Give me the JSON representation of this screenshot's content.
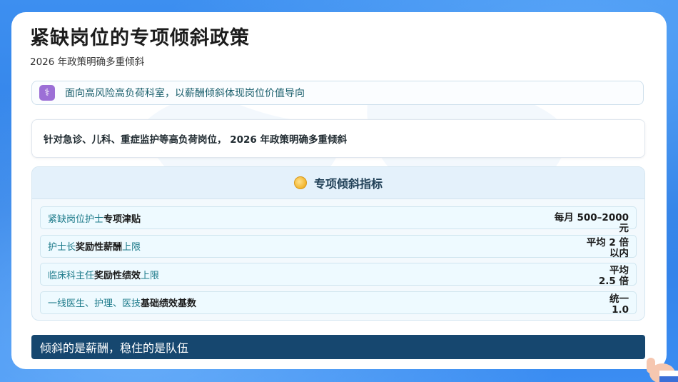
{
  "page": {
    "title": "紧缺岗位的专项倾斜政策",
    "subtitle": "2026 年政策明确多重倾斜"
  },
  "banner": {
    "icon": "medical-caduceus-icon",
    "text": "面向高风险高负荷科室，以薪酬倾斜体现岗位价值导向"
  },
  "summary": {
    "text": "针对急诊、儿科、重症监护等高负荷岗位， 2026 年政策明确多重倾斜"
  },
  "panel": {
    "icon": "coin-icon",
    "title": "专项倾斜指标",
    "rows": [
      {
        "prefix": "紧缺岗位护士",
        "bold": "专项津贴",
        "suffix": "",
        "value": "每月 500–2000 元"
      },
      {
        "prefix": "护士长",
        "bold": "奖励性薪酬",
        "suffix": "上限",
        "value": "平均 2 倍以内"
      },
      {
        "prefix": "临床科主任",
        "bold": "奖励性绩效",
        "suffix": "上限",
        "value": "平均 2.5 倍"
      },
      {
        "prefix": "一线医生、护理、医技",
        "bold": "基础绩效基数",
        "suffix": "",
        "value": "统一 1.0"
      }
    ]
  },
  "footer": {
    "text": "倾斜的是薪酬，稳住的是队伍"
  },
  "colors": {
    "background": "#3d8ff0",
    "footer": "#16476f",
    "accent_teal": "#1c7a8a",
    "banner_icon": "#9c6fd6"
  }
}
